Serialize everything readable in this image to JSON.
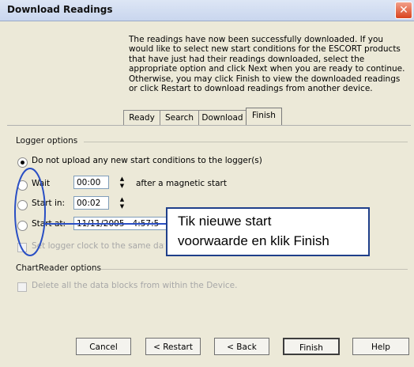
{
  "window": {
    "title": "Download Readings",
    "close_glyph": "✕"
  },
  "intro_text": "The readings have now been successfully downloaded. If you would like to select new start conditions for the ESCORT products that have just had their readings downloaded, select the appropriate option and click Next when you are ready to continue. Otherwise, you may click Finish to view the downloaded readings or click Restart to download readings from another device.",
  "tabs": [
    {
      "label": "Ready",
      "active": false
    },
    {
      "label": "Search",
      "active": false
    },
    {
      "label": "Download",
      "active": false
    },
    {
      "label": "Finish",
      "active": true
    }
  ],
  "logger_options": {
    "heading": "Logger options",
    "no_upload": {
      "label": "Do not upload any new start conditions to the logger(s)",
      "selected": true
    },
    "wait": {
      "label": "Wait",
      "value": "00:00",
      "suffix": "after a magnetic start",
      "selected": false
    },
    "start_in": {
      "label": "Start in:",
      "value": "00:02",
      "selected": false
    },
    "start_at": {
      "label": "Start at:",
      "value": "11/11/2005   4:57:5",
      "selected": false
    },
    "set_clock": {
      "label": "Set logger clock to the same date",
      "checked": false,
      "disabled": true
    }
  },
  "chartreader_options": {
    "heading": "ChartReader options",
    "delete_blocks": {
      "label": "Delete all the data blocks from within the Device.",
      "checked": false,
      "disabled": true
    }
  },
  "buttons": {
    "cancel": "Cancel",
    "restart": "< Restart",
    "back": "< Back",
    "finish": "Finish",
    "help": "Help"
  },
  "callout": {
    "line1": "Tik nieuwe start",
    "line2": "voorwaarde en klik Finish"
  },
  "colors": {
    "annotation_blue": "#2a4fc4",
    "close_red": "#d9431e"
  }
}
